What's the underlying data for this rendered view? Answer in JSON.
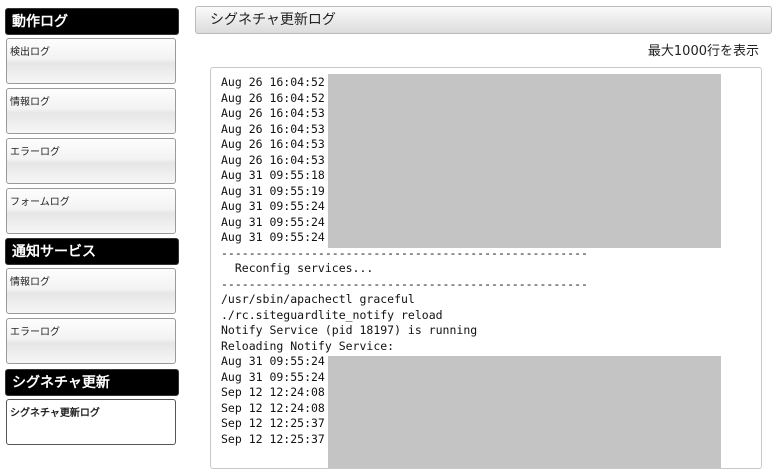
{
  "sidebar": {
    "sections": [
      {
        "title": "動作ログ",
        "items": [
          "検出ログ",
          "情報ログ",
          "エラーログ",
          "フォームログ"
        ]
      },
      {
        "title": "通知サービス",
        "items": [
          "情報ログ",
          "エラーログ"
        ]
      },
      {
        "title": "シグネチャ更新",
        "items": [
          "シグネチャ更新ログ"
        ]
      }
    ]
  },
  "main": {
    "title": "シグネチャ更新ログ",
    "max_lines_label": "最大1000行を表示",
    "log_lines": [
      "Aug 26 16:04:52",
      "Aug 26 16:04:52",
      "Aug 26 16:04:53",
      "Aug 26 16:04:53",
      "Aug 26 16:04:53",
      "Aug 26 16:04:53",
      "Aug 31 09:55:18",
      "Aug 31 09:55:19",
      "Aug 31 09:55:24",
      "Aug 31 09:55:24",
      "Aug 31 09:55:24",
      "-----------------------------------------------------",
      "  Reconfig services...",
      "-----------------------------------------------------",
      "/usr/sbin/apachectl graceful",
      "./rc.siteguardlite_notify reload",
      "Notify Service (pid 18197) is running",
      "Reloading Notify Service:",
      "Aug 31 09:55:24",
      "Aug 31 09:55:24",
      "Sep 12 12:24:08",
      "Sep 12 12:24:08",
      "Sep 12 12:25:37",
      "Sep 12 12:25:37"
    ]
  }
}
